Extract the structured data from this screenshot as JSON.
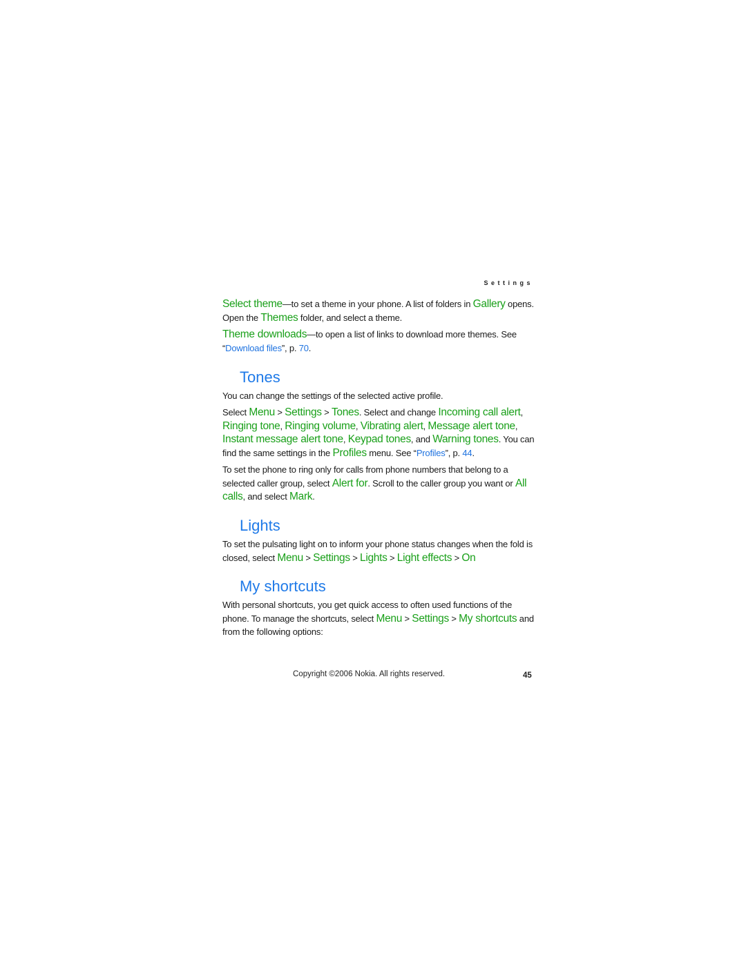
{
  "running_head": "Settings",
  "theme": {
    "select_theme": {
      "term": "Select theme",
      "t1": "—to set a theme in your phone. A list of folders in ",
      "gallery": "Gallery",
      "t2": " opens. Open the ",
      "themes": "Themes",
      "t3": " folder, and select a theme."
    },
    "theme_downloads": {
      "term": "Theme downloads",
      "t1": "—to open a list of links to download more themes. See “",
      "link": "Download files",
      "t2": "”, p. ",
      "page": "70",
      "t3": "."
    }
  },
  "tones": {
    "heading": "Tones",
    "intro": "You can change the settings of the selected active profile.",
    "p2": {
      "t0": "Select ",
      "menu": "Menu",
      "sep1": " > ",
      "settings": "Settings",
      "sep2": " > ",
      "tones": "Tones",
      "t1": ". Select and change ",
      "i1": "Incoming call alert",
      "c1": ", ",
      "i2": "Ringing tone",
      "c2": ", ",
      "i3": "Ringing volume",
      "c3": ", ",
      "i4": "Vibrating alert",
      "c4": ", ",
      "i5": "Message alert tone",
      "c5": ", ",
      "i6": "Instant message alert tone",
      "c6": ", ",
      "i7": "Keypad tones",
      "c7": ", and ",
      "i8": "Warning tones",
      "t2": ". You can find the same settings in the ",
      "profiles": "Profiles",
      "t3": " menu. See “",
      "link": "Profiles",
      "t4": "”, p. ",
      "page": "44",
      "t5": "."
    },
    "p3": {
      "t0": "To set the phone to ring only for calls from phone numbers that belong to a selected caller group, select ",
      "alert_for": "Alert for",
      "t1": ". Scroll to the caller group you want or ",
      "all_calls": "All calls",
      "t2": ", and select ",
      "mark": "Mark",
      "t3": "."
    }
  },
  "lights": {
    "heading": "Lights",
    "p": {
      "t0": "To set the pulsating light on to inform your phone status changes when the fold is closed, select ",
      "menu": "Menu",
      "sep1": " > ",
      "settings": "Settings",
      "sep2": " > ",
      "lights": "Lights",
      "sep3": " > ",
      "effects": "Light effects",
      "sep4": " > ",
      "on": "On"
    }
  },
  "shortcuts": {
    "heading": "My shortcuts",
    "p": {
      "t0": "With personal shortcuts, you get quick access to often used functions of the phone. To manage the shortcuts, select ",
      "menu": "Menu",
      "sep1": " > ",
      "settings": "Settings",
      "sep2": " > ",
      "my_shortcuts": "My shortcuts",
      "t1": " and from the following options:"
    }
  },
  "footer": {
    "copyright": "Copyright ©2006 Nokia. All rights reserved.",
    "page_number": "45"
  }
}
